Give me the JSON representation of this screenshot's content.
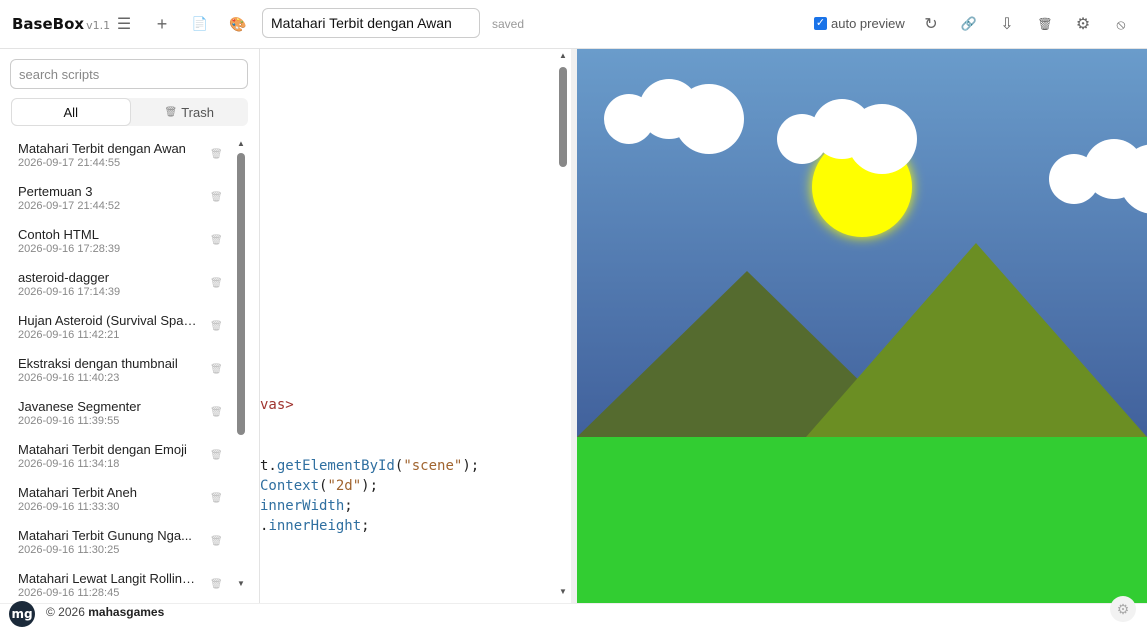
{
  "app": {
    "name": "BaseBox",
    "version": "v1.1"
  },
  "toolbar": {
    "menu_icon": "☰",
    "new_icon": "+",
    "doc_icon": "📄",
    "palette_icon": "🎨",
    "title_value": "Matahari Terbit dengan Awan",
    "status": "saved",
    "auto_preview_label": "auto preview",
    "auto_preview_checked": "✓",
    "reload_icon": "↻",
    "link_icon": "🔗",
    "download_icon": "⇩",
    "trash_icon": "🗑",
    "settings_icon": "⚙",
    "block_icon": "⦸"
  },
  "sidebar": {
    "search_placeholder": "search scripts",
    "tabs": [
      {
        "label": "All",
        "icon": ""
      },
      {
        "label": "Trash",
        "icon": "🗑"
      }
    ],
    "delete_icon": "🗑",
    "items": [
      {
        "name": "Matahari Terbit dengan Awan",
        "date": "2026-09-17 21:44:55"
      },
      {
        "name": "Pertemuan 3",
        "date": "2026-09-17 21:44:52"
      },
      {
        "name": "Contoh HTML",
        "date": "2026-09-16 17:28:39"
      },
      {
        "name": "asteroid-dagger",
        "date": "2026-09-16 17:14:39"
      },
      {
        "name": "Hujan Asteroid (Survival Space)",
        "date": "2026-09-16 11:42:21"
      },
      {
        "name": "Ekstraksi dengan thumbnail",
        "date": "2026-09-16 11:40:23"
      },
      {
        "name": "Javanese Segmenter",
        "date": "2026-09-16 11:39:55"
      },
      {
        "name": "Matahari Terbit dengan Emoji",
        "date": "2026-09-16 11:34:18"
      },
      {
        "name": "Matahari Terbit Aneh",
        "date": "2026-09-16 11:33:30"
      },
      {
        "name": "Matahari Terbit Gunung Nga...",
        "date": "2026-09-16 11:30:25"
      },
      {
        "name": "Matahari Lewat Langit Rolling...",
        "date": "2026-09-16 11:28:45"
      }
    ]
  },
  "editor": {
    "lines": [
      {
        "parts": [
          {
            "t": "vas>",
            "c": "tag"
          }
        ]
      },
      {
        "parts": [
          {
            "t": "t.",
            "c": "plain"
          },
          {
            "t": "getElementById",
            "c": "fn"
          },
          {
            "t": "(",
            "c": "plain"
          },
          {
            "t": "\"scene\"",
            "c": "str"
          },
          {
            "t": ");",
            "c": "plain"
          }
        ]
      },
      {
        "parts": [
          {
            "t": "Context",
            "c": "fn"
          },
          {
            "t": "(",
            "c": "plain"
          },
          {
            "t": "\"2d\"",
            "c": "str"
          },
          {
            "t": ");",
            "c": "plain"
          }
        ]
      },
      {
        "parts": [
          {
            "t": "innerWidth",
            "c": "fn"
          },
          {
            "t": ";",
            "c": "plain"
          }
        ]
      },
      {
        "parts": [
          {
            "t": ".",
            "c": "plain"
          },
          {
            "t": "innerHeight",
            "c": "fn"
          },
          {
            "t": ";",
            "c": "plain"
          }
        ]
      }
    ]
  },
  "footer": {
    "avatar_text": "mg",
    "copyright": "© 2026",
    "owner": "mahasgames",
    "gear_icon": "⚙"
  },
  "colors": {
    "sky_top": "#6a9ccb",
    "sky_bottom": "#41619c",
    "sun": "#ffff00",
    "mountain_dark": "#556b2f",
    "mountain_light": "#6b8e23",
    "grass": "#32cd32",
    "accent": "#1a73e8"
  }
}
